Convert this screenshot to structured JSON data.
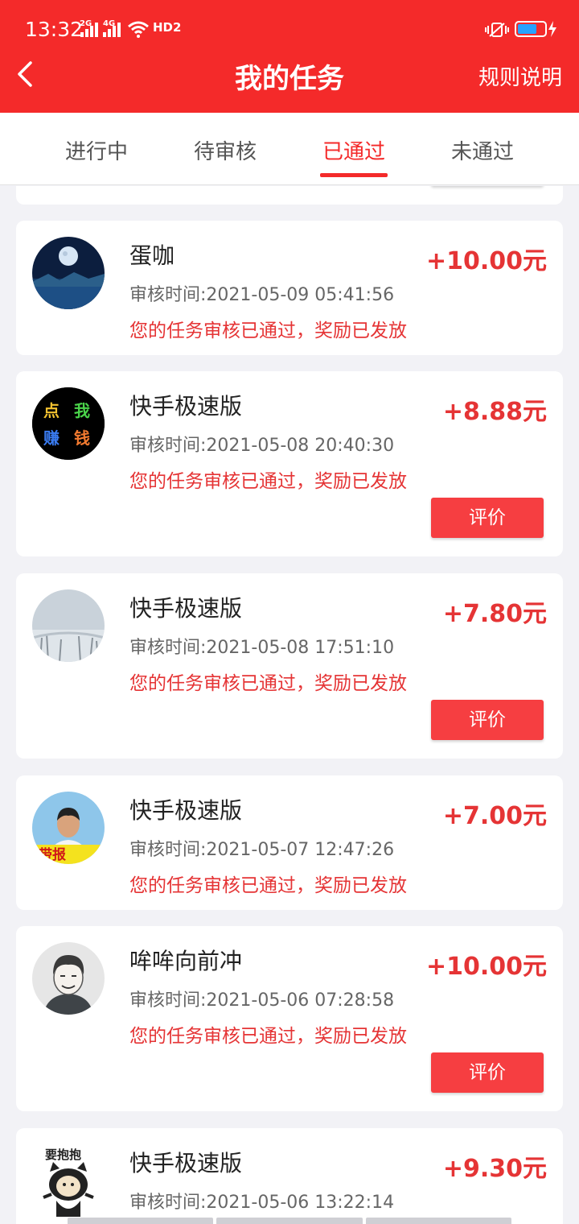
{
  "status_bar": {
    "time": "13:32",
    "signal1": "2G",
    "signal2": "4G",
    "hd": "HD2"
  },
  "header": {
    "title": "我的任务",
    "rules_label": "规则说明"
  },
  "tabs": [
    "进行中",
    "待审核",
    "已通过",
    "未通过"
  ],
  "active_tab": "已通过",
  "colors": {
    "brand_red": "#f42a2a",
    "amount_red": "#e53435",
    "button_red": "#f63e41",
    "battery_blue": "#27a2ff"
  },
  "battery_level": 0.72,
  "tasks": [
    {
      "name": "蛋咖",
      "amount": "+10.00元",
      "time": "审核时间:2021-05-09 05:41:56",
      "message": "您的任务审核已通过，奖励已发放",
      "avatar": "moon-night-avatar"
    },
    {
      "name": "快手极速版",
      "amount": "+8.88元",
      "time": "审核时间:2021-05-08 20:40:30",
      "message": "您的任务审核已通过，奖励已发放",
      "button": "评价",
      "avatar": "click-earn-avatar",
      "avatar_text": [
        "点",
        "我",
        "赚",
        "钱"
      ]
    },
    {
      "name": "快手极速版",
      "amount": "+7.80元",
      "time": "审核时间:2021-05-08 17:51:10",
      "message": "您的任务审核已通过，奖励已发放",
      "button": "评价",
      "avatar": "foggy-trees-avatar"
    },
    {
      "name": "快手极速版",
      "amount": "+7.00元",
      "time": "审核时间:2021-05-07 12:47:26",
      "message": "您的任务审核已通过，奖励已发放",
      "avatar": "man-banner-avatar",
      "avatar_text": "带报"
    },
    {
      "name": "哞哞向前冲",
      "amount": "+10.00元",
      "time": "审核时间:2021-05-06 07:28:58",
      "message": "您的任务审核已通过，奖励已发放",
      "button": "评价",
      "avatar": "cartoon-man-avatar"
    },
    {
      "name": "快手极速版",
      "amount": "+9.30元",
      "time": "审核时间:2021-05-06 13:22:14",
      "message": "",
      "avatar": "cat-hug-avatar",
      "avatar_text": "要抱抱"
    }
  ]
}
